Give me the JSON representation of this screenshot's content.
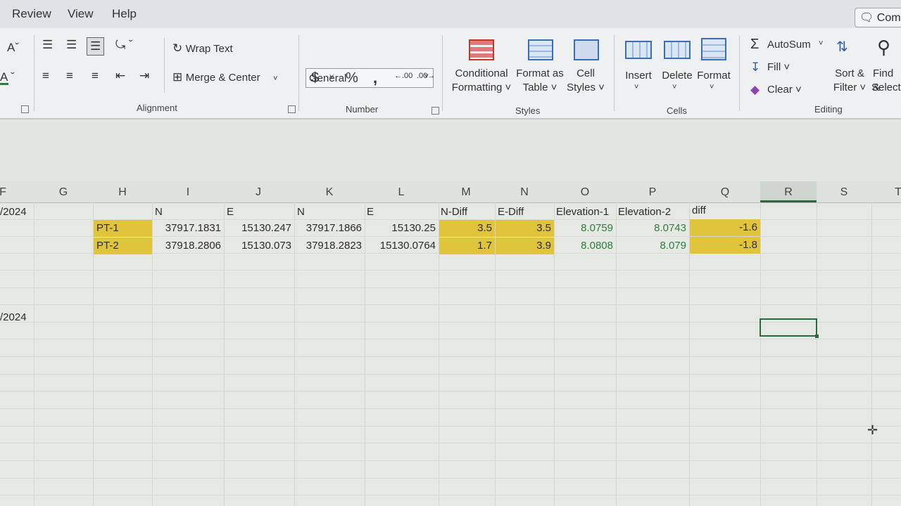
{
  "menu": {
    "review": "Review",
    "view": "View",
    "help": "Help",
    "comments": "Com"
  },
  "ribbon": {
    "font_grow": "Aˇ",
    "wrap_text": "Wrap Text",
    "merge_center": "Merge & Center",
    "alignment_label": "Alignment",
    "number_format": "General",
    "currency": "$",
    "percent": "%",
    "comma": "͗",
    "inc_decimal": "←.00",
    "dec_decimal": ".00→",
    "number_label": "Number",
    "cond_format_1": "Conditional",
    "cond_format_2": "Formatting ˅",
    "format_table_1": "Format as",
    "format_table_2": "Table ˅",
    "cell_styles_1": "Cell",
    "cell_styles_2": "Styles ˅",
    "styles_label": "Styles",
    "insert": "Insert",
    "delete": "Delete",
    "format": "Format",
    "cells_label": "Cells",
    "autosum": "AutoSum",
    "fill": "Fill ˅",
    "clear": "Clear ˅",
    "sort_1": "Sort &",
    "sort_2": "Filter ˅",
    "find_1": "Find &",
    "find_2": "Select",
    "editing_label": "Editing"
  },
  "columns": [
    "F",
    "G",
    "H",
    "I",
    "J",
    "K",
    "L",
    "M",
    "N",
    "O",
    "P",
    "Q",
    "R",
    "S",
    "T"
  ],
  "selected_column": "R",
  "left_dates": [
    "/2024",
    "/2024"
  ],
  "header_row": {
    "i": "N",
    "j": "E",
    "k": "N",
    "l": "E",
    "m": "N-Diff",
    "n": "E-Diff",
    "o": "Elevation-1",
    "p": "Elevation-2",
    "q": "diff"
  },
  "rows": [
    {
      "h": "PT-1",
      "i": "37917.1831",
      "j": "15130.247",
      "k": "37917.1866",
      "l": "15130.25",
      "m": "3.5",
      "n": "3.5",
      "o": "8.0759",
      "p": "8.0743",
      "q": "-1.6"
    },
    {
      "h": "PT-2",
      "i": "37918.2806",
      "j": "15130.073",
      "k": "37918.2823",
      "l": "15130.0764",
      "m": "1.7",
      "n": "3.9",
      "o": "8.0808",
      "p": "8.079",
      "q": "-1.8"
    }
  ],
  "colors": {
    "highlight": "#e0c43c",
    "green_text": "#2f7d3a",
    "selection": "#2b6a3f"
  }
}
